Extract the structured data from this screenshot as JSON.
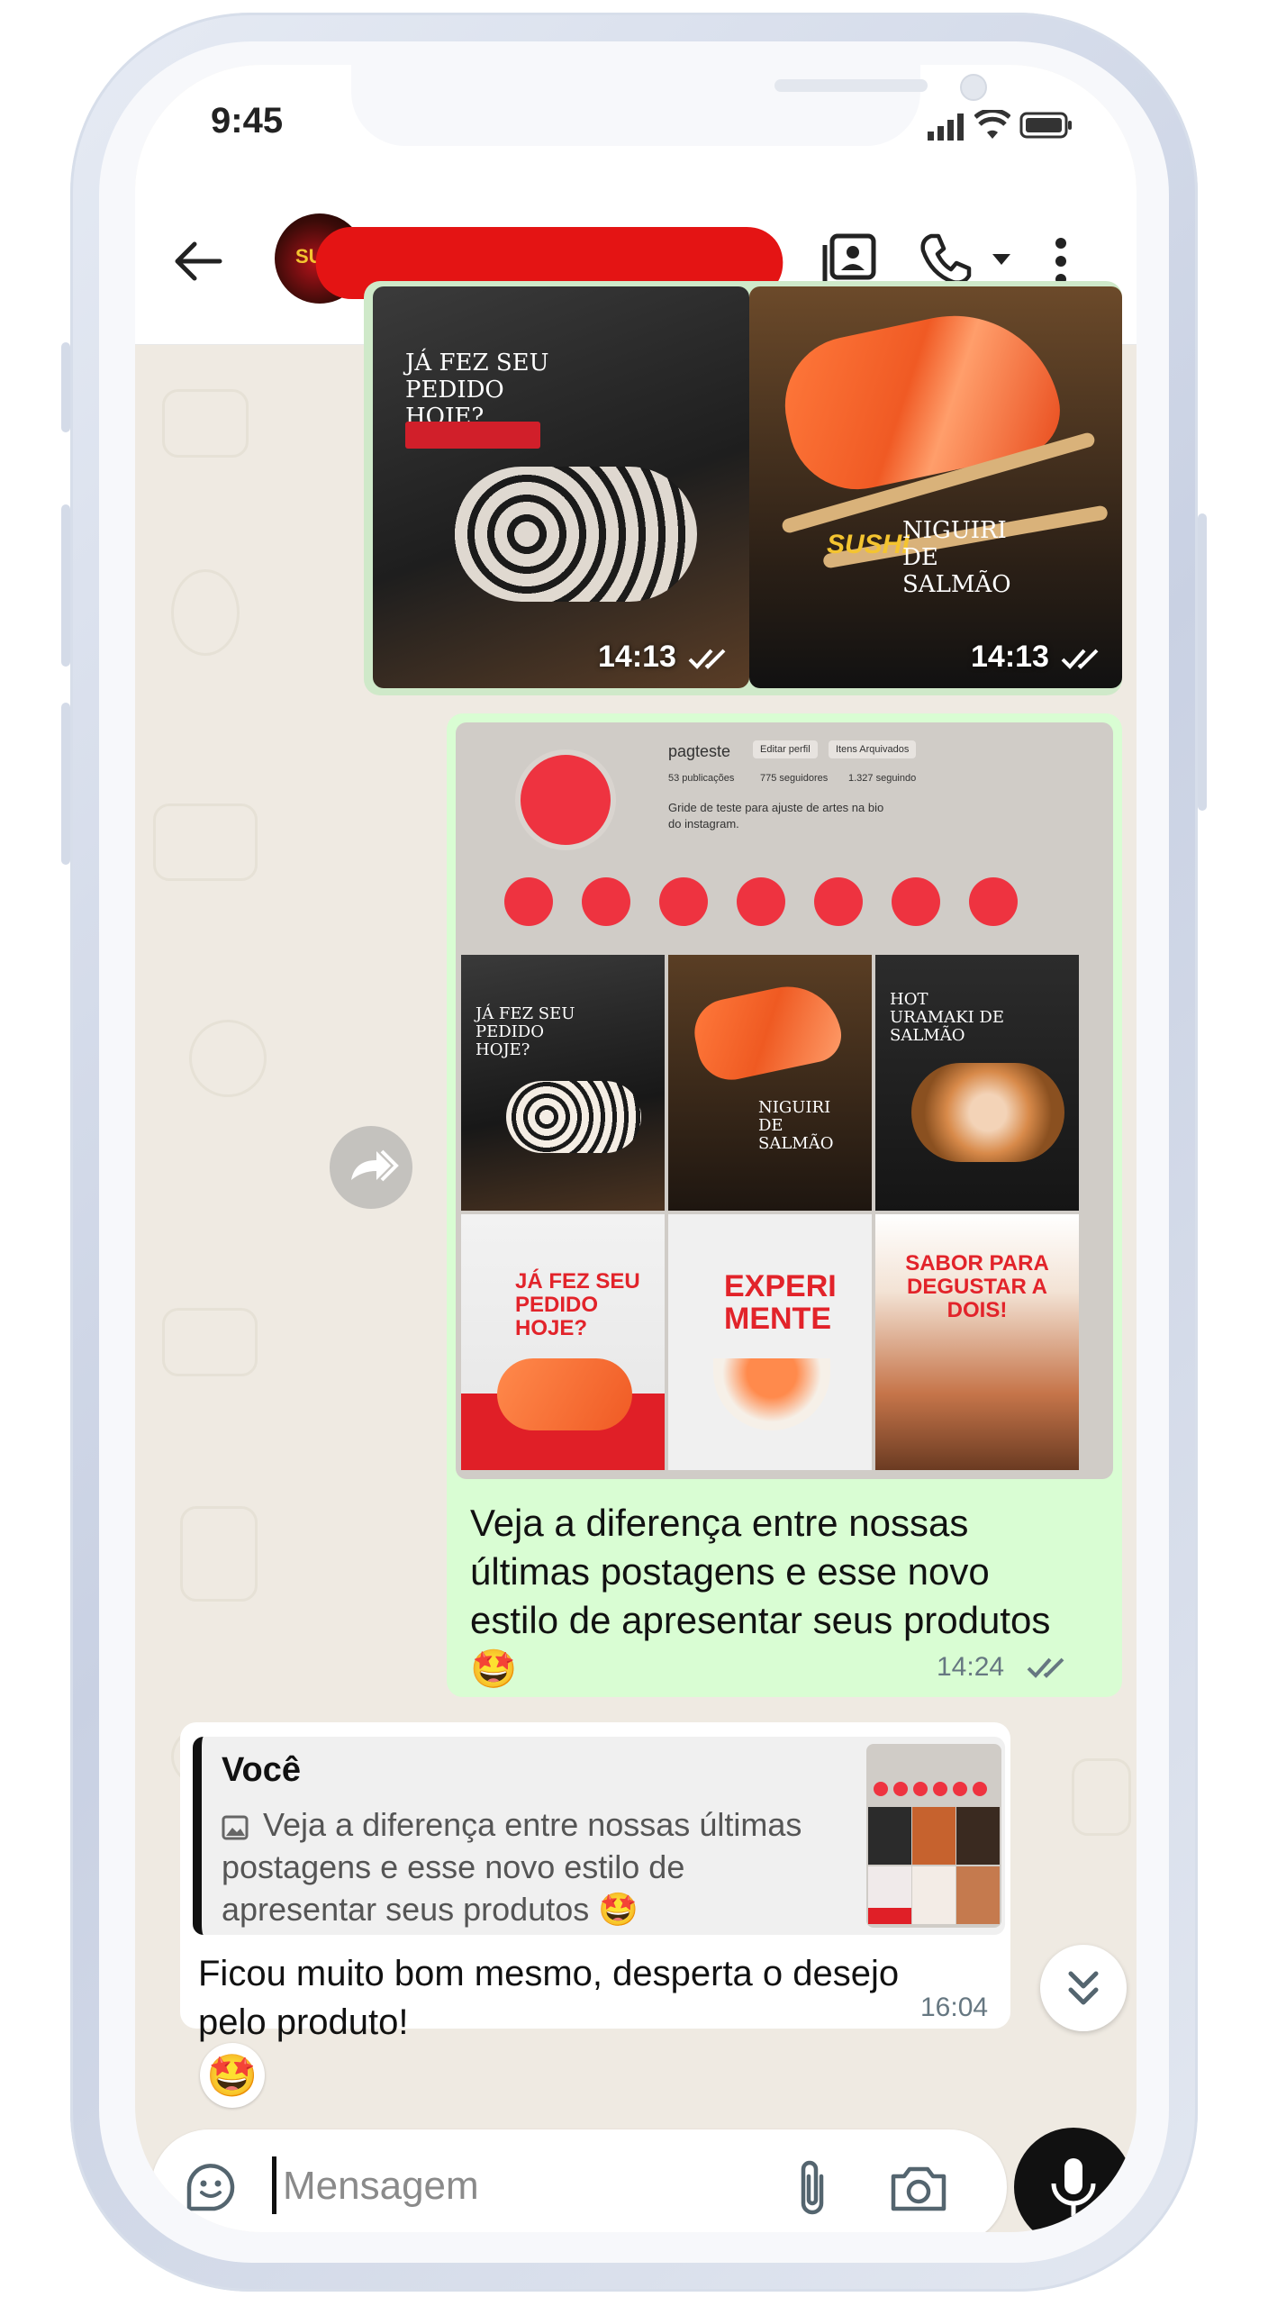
{
  "status_bar": {
    "time": "9:45"
  },
  "chat_header": {
    "contact_name": "(redacted)",
    "last_seen": "(redacted)",
    "avatar_text": "SUSHI"
  },
  "messages": {
    "album": {
      "photo_left_caption": "JÁ FEZ SEU PEDIDO HOJE?",
      "photo_left_time": "14:13",
      "photo_right_caption": "NIGUIRI DE SALMÃO",
      "photo_right_brand": "SUSHI",
      "photo_right_time": "14:13"
    },
    "instagram_preview": {
      "profile_name": "pagteste",
      "edit_profile": "Editar perfil",
      "archived": "Itens Arquivados",
      "publications": "53 publicações",
      "followers": "775 seguidores",
      "following": "1.327 seguindo",
      "bio": "Gride de teste para ajuste de artes na bio do instagram.",
      "tiles": [
        {
          "label": "JÁ FEZ SEU PEDIDO HOJE?"
        },
        {
          "label": "NIGUIRI DE SALMÃO"
        },
        {
          "label": "HOT URAMAKI DE SALMÃO"
        },
        {
          "label": "JÁ FEZ SEU PEDIDO HOJE?"
        },
        {
          "label": "EXPERI MENTE"
        },
        {
          "label": "SABOR PARA DEGUSTAR A DOIS!"
        }
      ],
      "caption": "Veja a diferença entre nossas últimas postagens e esse novo estilo de apresentar seus produtos 🤩",
      "time": "14:24"
    },
    "reply": {
      "quoted_author": "Você",
      "quoted_text": "Veja a diferença entre nossas últimas postagens e esse novo estilo de apresentar seus produtos 🤩",
      "text": "Ficou muito bom mesmo, desperta o desejo pelo produto!",
      "time": "16:04",
      "reaction": "🤩"
    }
  },
  "composer": {
    "placeholder": "Mensagem"
  },
  "icons": {
    "back": "arrow-left-icon",
    "contact_card": "contact-card-icon",
    "call": "phone-icon",
    "call_dropdown": "caret-down-icon",
    "more": "more-vertical-icon",
    "forward": "forward-icon",
    "double_check": "double-check-icon",
    "sticker": "sticker-icon",
    "attach": "paperclip-icon",
    "camera": "camera-icon",
    "mic": "mic-icon",
    "scroll_down": "double-chevron-down-icon"
  },
  "colors": {
    "outgoing_bubble": "#d9fdd3",
    "incoming_bubble": "#ffffff",
    "chat_bg": "#efeae2",
    "accent_red": "#e2232a"
  }
}
